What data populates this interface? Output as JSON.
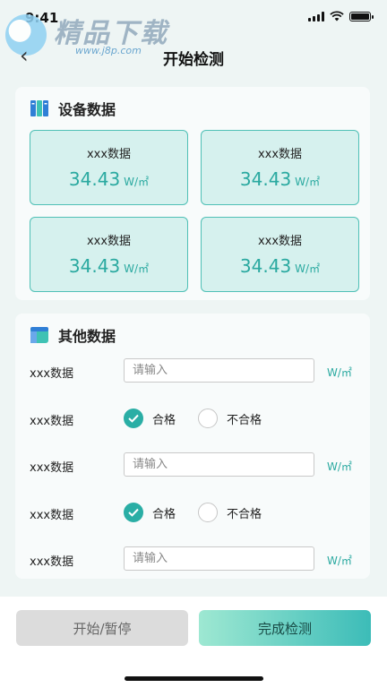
{
  "status_bar": {
    "time": "9:41"
  },
  "watermark": {
    "title": "精品下载",
    "url": "www.j8p.com"
  },
  "header": {
    "title": "开始检测"
  },
  "device_section": {
    "title": "设备数据",
    "tiles": [
      {
        "label": "xxx数据",
        "value": "34.43",
        "unit": "W/㎡"
      },
      {
        "label": "xxx数据",
        "value": "34.43",
        "unit": "W/㎡"
      },
      {
        "label": "xxx数据",
        "value": "34.43",
        "unit": "W/㎡"
      },
      {
        "label": "xxx数据",
        "value": "34.43",
        "unit": "W/㎡"
      }
    ]
  },
  "other_section": {
    "title": "其他数据",
    "rows": [
      {
        "label": "xxx数据",
        "placeholder": "请输入",
        "unit": "W/㎡"
      },
      {
        "label": "xxx数据",
        "option_pass": "合格",
        "option_fail": "不合格",
        "selected": "合格"
      },
      {
        "label": "xxx数据",
        "placeholder": "请输入",
        "unit": "W/㎡"
      },
      {
        "label": "xxx数据",
        "option_pass": "合格",
        "option_fail": "不合格",
        "selected": "合格"
      },
      {
        "label": "xxx数据",
        "placeholder": "请输入",
        "unit": "W/㎡"
      }
    ]
  },
  "footer": {
    "start_pause": "开始/暂停",
    "finish": "完成检测"
  },
  "colors": {
    "accent": "#2aa9a0",
    "tile_bg": "#d6f1ee",
    "tile_border": "#4fc0b6"
  }
}
